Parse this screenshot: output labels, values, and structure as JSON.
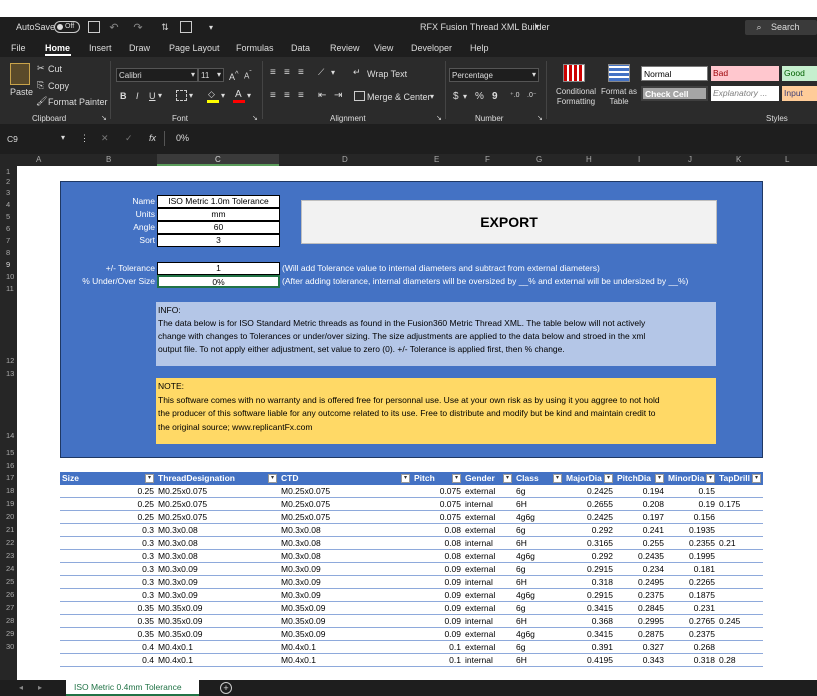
{
  "titlebar": {
    "autosave": "AutoSave",
    "toggle": "Off",
    "title": "RFX Fusion Thread XML Builder",
    "search": "Search"
  },
  "menu": [
    "File",
    "Home",
    "Insert",
    "Draw",
    "Page Layout",
    "Formulas",
    "Data",
    "Review",
    "View",
    "Developer",
    "Help"
  ],
  "ribbon": {
    "clipboard": {
      "paste": "Paste",
      "cut": "Cut",
      "copy": "Copy",
      "format_painter": "Format Painter",
      "group": "Clipboard"
    },
    "font": {
      "name": "Calibri",
      "size": "11",
      "group": "Font",
      "bold": "B",
      "italic": "I",
      "underline": "U"
    },
    "alignment": {
      "wrap": "Wrap Text",
      "merge": "Merge & Center",
      "group": "Alignment"
    },
    "number": {
      "format": "Percentage",
      "group": "Number",
      "currency": "$",
      "percent": "%",
      "comma": "9"
    },
    "styles": {
      "conditional": "Conditional Formatting",
      "format_table": "Format as Table",
      "normal": "Normal",
      "bad": "Bad",
      "good": "Good",
      "check": "Check Cell",
      "explanatory": "Explanatory ...",
      "input": "Input",
      "group": "Styles"
    }
  },
  "formula_bar": {
    "cell": "C9",
    "fx": "fx",
    "value": "0%"
  },
  "columns": [
    "A",
    "B",
    "C",
    "D",
    "E",
    "F",
    "G",
    "H",
    "I",
    "J",
    "K",
    "L"
  ],
  "rows": [
    "1",
    "2",
    "3",
    "4",
    "5",
    "6",
    "7",
    "8",
    "9",
    "10",
    "11",
    "12",
    "13",
    "14",
    "15",
    "16",
    "17",
    "18",
    "19",
    "20",
    "21",
    "22",
    "23",
    "24",
    "25",
    "26",
    "27",
    "28",
    "29",
    "30"
  ],
  "settings": [
    {
      "label": "Name",
      "value": "ISO Metric 1.0m Tolerance"
    },
    {
      "label": "Units",
      "value": "mm"
    },
    {
      "label": "Angle",
      "value": "60"
    },
    {
      "label": "Sort",
      "value": "3"
    }
  ],
  "export_label": "EXPORT",
  "tolerance": {
    "label": "+/- Tolerance",
    "value": "1",
    "note": "(Will add Tolerance value to internal diameters and subtract from external diameters)"
  },
  "underover": {
    "label": "% Under/Over Size",
    "value": "0%",
    "note": "(After adding tolerance, internal diameters will be oversized by __% and external will be undersized by __%)"
  },
  "info": {
    "lines": [
      "INFO:",
      "The data below is for  ISO Standard Metric threads as found in the Fusion360 Metric Thread XML.  The table below will not actively",
      "change with changes to Tolerances or under/over sizing.  The size adjustments are applied to the data below and stroed in the xml",
      "output file.  To not apply either adjustment, set value to zero (0).  +/- Tolerance is applied first, then % change."
    ]
  },
  "note": {
    "lines": [
      "NOTE:",
      "This software comes with no warranty and is offered free for personnal use.  Use at your own risk as by using it you aggree to not hold",
      "the producer of this software liable for any outcome related to its use.  Free to distribute and modify but be kind and maintain credit to",
      "the original source; www.replicantFx.com"
    ]
  },
  "table": {
    "headers": [
      "Size",
      "ThreadDesignation",
      "CTD",
      "Pitch",
      "Gender",
      "Class",
      "MajorDia",
      "PitchDia",
      "MinorDia",
      "TapDrill"
    ],
    "rows": [
      [
        "0.25",
        "M0.25x0.075",
        "M0.25x0.075",
        "0.075",
        "external",
        "6g",
        "0.2425",
        "0.194",
        "0.15",
        ""
      ],
      [
        "0.25",
        "M0.25x0.075",
        "M0.25x0.075",
        "0.075",
        "internal",
        "6H",
        "0.2655",
        "0.208",
        "0.19",
        "0.175"
      ],
      [
        "0.25",
        "M0.25x0.075",
        "M0.25x0.075",
        "0.075",
        "external",
        "4g6g",
        "0.2425",
        "0.197",
        "0.156",
        ""
      ],
      [
        "0.3",
        "M0.3x0.08",
        "M0.3x0.08",
        "0.08",
        "external",
        "6g",
        "0.292",
        "0.241",
        "0.1935",
        ""
      ],
      [
        "0.3",
        "M0.3x0.08",
        "M0.3x0.08",
        "0.08",
        "internal",
        "6H",
        "0.3165",
        "0.255",
        "0.2355",
        "0.21"
      ],
      [
        "0.3",
        "M0.3x0.08",
        "M0.3x0.08",
        "0.08",
        "external",
        "4g6g",
        "0.292",
        "0.2435",
        "0.1995",
        ""
      ],
      [
        "0.3",
        "M0.3x0.09",
        "M0.3x0.09",
        "0.09",
        "external",
        "6g",
        "0.2915",
        "0.234",
        "0.181",
        ""
      ],
      [
        "0.3",
        "M0.3x0.09",
        "M0.3x0.09",
        "0.09",
        "internal",
        "6H",
        "0.318",
        "0.2495",
        "0.2265",
        ""
      ],
      [
        "0.3",
        "M0.3x0.09",
        "M0.3x0.09",
        "0.09",
        "external",
        "4g6g",
        "0.2915",
        "0.2375",
        "0.1875",
        ""
      ],
      [
        "0.35",
        "M0.35x0.09",
        "M0.35x0.09",
        "0.09",
        "external",
        "6g",
        "0.3415",
        "0.2845",
        "0.231",
        ""
      ],
      [
        "0.35",
        "M0.35x0.09",
        "M0.35x0.09",
        "0.09",
        "internal",
        "6H",
        "0.368",
        "0.2995",
        "0.2765",
        "0.245"
      ],
      [
        "0.35",
        "M0.35x0.09",
        "M0.35x0.09",
        "0.09",
        "external",
        "4g6g",
        "0.3415",
        "0.2875",
        "0.2375",
        ""
      ],
      [
        "0.4",
        "M0.4x0.1",
        "M0.4x0.1",
        "0.1",
        "external",
        "6g",
        "0.391",
        "0.327",
        "0.268",
        ""
      ],
      [
        "0.4",
        "M0.4x0.1",
        "M0.4x0.1",
        "0.1",
        "internal",
        "6H",
        "0.4195",
        "0.343",
        "0.318",
        "0.28"
      ]
    ]
  },
  "sheet_tab": "ISO Metric 0.4mm Tolerance",
  "colors": {
    "panel": "#4472c4",
    "info_box": "#b4c6e7",
    "note_box": "#ffd966",
    "header_row": "#4472c4"
  }
}
